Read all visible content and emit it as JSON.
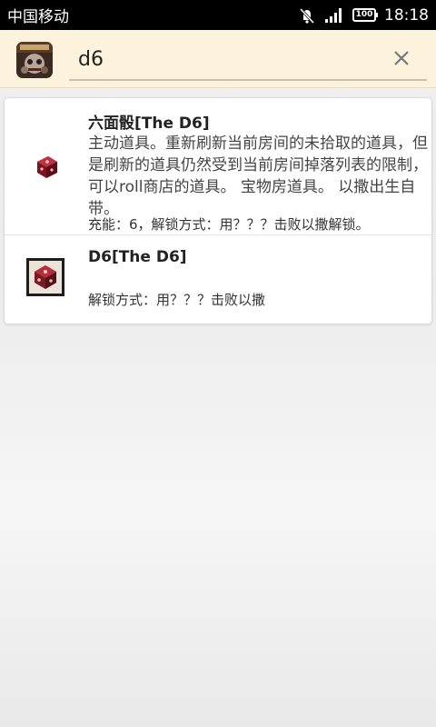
{
  "status_bar": {
    "carrier": "中国移动",
    "battery": "100",
    "time": "18:18",
    "icons": [
      "mute-icon",
      "signal-icon",
      "battery-icon"
    ]
  },
  "search": {
    "query": "d6",
    "app_icon": "app-logo-icon",
    "clear_icon": "close-icon"
  },
  "results": [
    {
      "title": "六面骰[The D6]",
      "description": "主动道具。重新刷新当前房间的未拾取的道具，但是刷新的道具仍然受到当前房间掉落列表的限制，可以roll商店的道具。 宝物房道具。 以撒出生自带。",
      "meta": "充能：6，解锁方式：用？？？击败以撒解锁。",
      "icon": "red-dice-icon"
    },
    {
      "title": "D6[The D6]",
      "description": "",
      "meta": "解锁方式：用？？？击败以撒",
      "icon": "dice-card-icon"
    }
  ],
  "colors": {
    "header_bg": "#fdf3dc",
    "status_bg": "#000000",
    "dice_red": "#9c1d2b"
  }
}
